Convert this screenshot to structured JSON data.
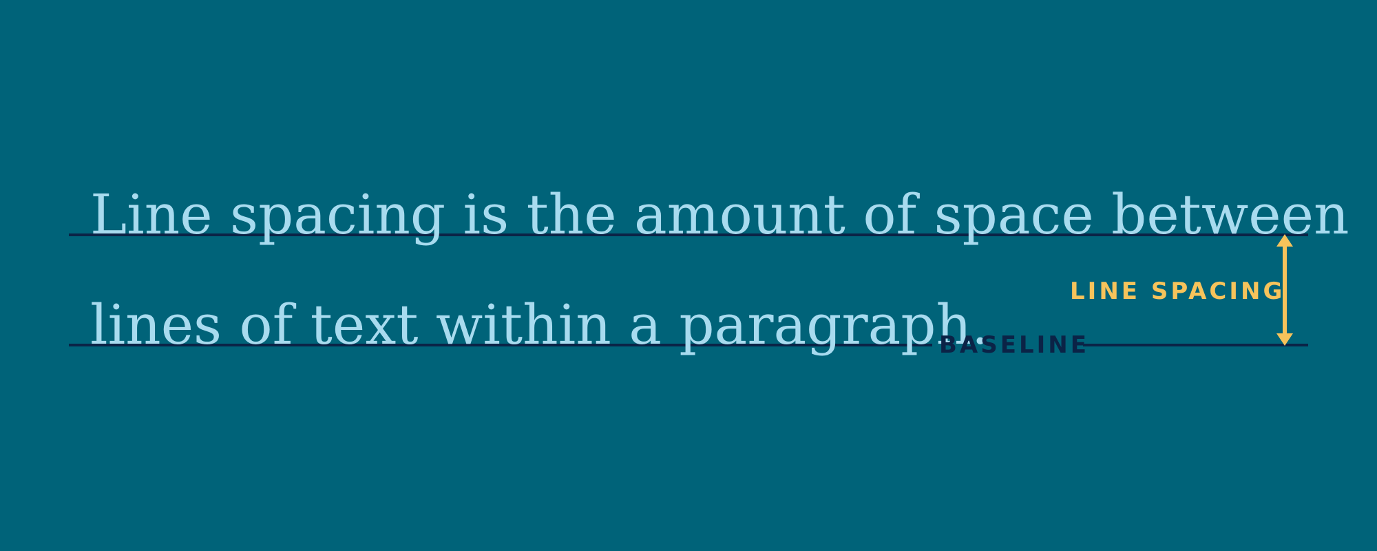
{
  "paragraph": {
    "line1": "Line spacing is the amount of space between",
    "line2": "lines of text within a paragraph."
  },
  "labels": {
    "baseline": "BASELINE",
    "line_spacing": "LINE SPACING"
  },
  "colors": {
    "background": "#006379",
    "text": "#a8dbef",
    "baseline_rule": "#0b2346",
    "accent": "#f6c35b"
  },
  "icons": {
    "spacing_arrow": "double-headed-vertical-arrow-icon"
  }
}
